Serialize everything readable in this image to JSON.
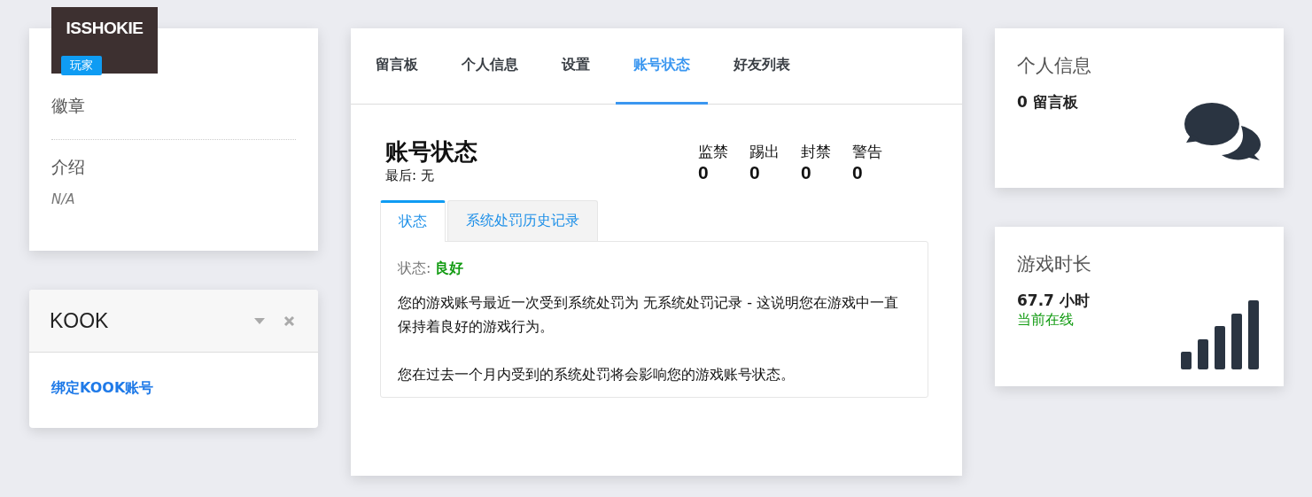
{
  "profile": {
    "name": "ISSHOKIE",
    "badge": "玩家",
    "badges_label": "徽章",
    "intro_label": "介绍",
    "intro_value": "N/A"
  },
  "kook": {
    "title": "KOOK",
    "link": "绑定KOOK账号"
  },
  "nav_tabs": [
    {
      "label": "留言板",
      "selected": false
    },
    {
      "label": "个人信息",
      "selected": false
    },
    {
      "label": "设置",
      "selected": false
    },
    {
      "label": "账号状态",
      "selected": true
    },
    {
      "label": "好友列表",
      "selected": false
    }
  ],
  "account": {
    "title": "账号状态",
    "last": "最后: 无",
    "counters": [
      {
        "label": "监禁",
        "value": "0"
      },
      {
        "label": "踢出",
        "value": "0"
      },
      {
        "label": "封禁",
        "value": "0"
      },
      {
        "label": "警告",
        "value": "0"
      }
    ],
    "subtabs": [
      {
        "label": "状态",
        "selected": true
      },
      {
        "label": "系统处罚历史记录",
        "selected": false
      }
    ],
    "status_label": "状态:",
    "status_value": "良好",
    "paragraphs": [
      "您的游戏账号最近一次受到系统处罚为 无系统处罚记录 - 这说明您在游戏中一直保持着良好的游戏行为。",
      "您在过去一个月内受到的系统处罚将会影响您的游戏账号状态。"
    ]
  },
  "stats": [
    {
      "kind": "messages",
      "title": "个人信息",
      "value": "0 留言板"
    },
    {
      "kind": "playtime",
      "title": "游戏时长",
      "value": "67.7 小时",
      "note": "当前在线"
    }
  ]
}
